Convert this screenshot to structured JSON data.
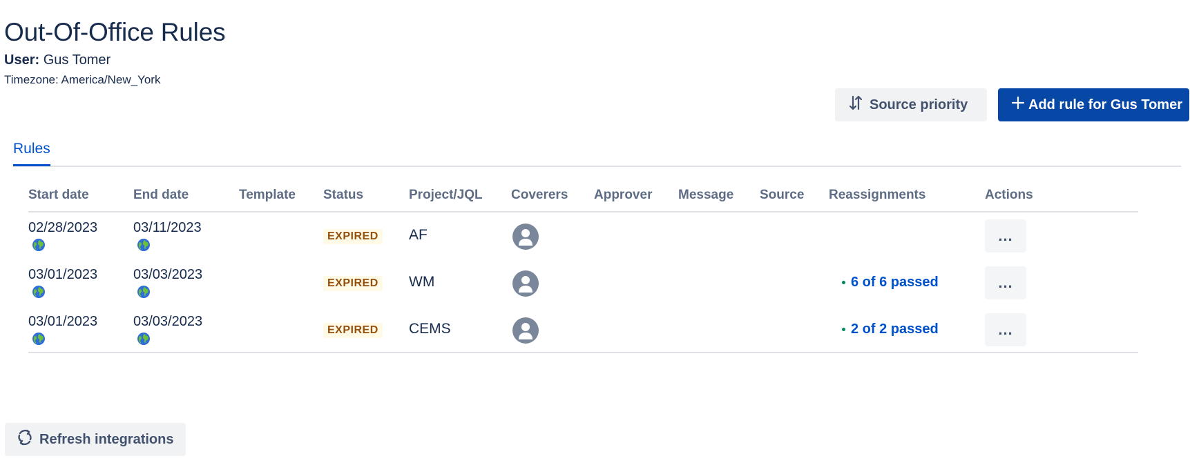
{
  "header": {
    "title": "Out-Of-Office Rules",
    "user_label": "User:",
    "user_name": "Gus Tomer",
    "timezone_text": "Timezone: America/New_York"
  },
  "toolbar": {
    "source_priority_label": "Source priority",
    "add_rule_label": "Add rule for Gus Tomer"
  },
  "tabs": [
    {
      "label": "Rules",
      "active": true
    }
  ],
  "table": {
    "columns": [
      "Start date",
      "End date",
      "Template",
      "Status",
      "Project/JQL",
      "Coverers",
      "Approver",
      "Message",
      "Source",
      "Reassignments",
      "Actions"
    ],
    "rows": [
      {
        "start_date": "02/28/2023",
        "end_date": "03/11/2023",
        "template": "",
        "status": "EXPIRED",
        "project": "AF",
        "coverer_icon": "user-avatar-icon",
        "approver": "",
        "message": "",
        "source": "",
        "reassignments": "",
        "actions": "..."
      },
      {
        "start_date": "03/01/2023",
        "end_date": "03/03/2023",
        "template": "",
        "status": "EXPIRED",
        "project": "WM",
        "coverer_icon": "user-avatar-icon",
        "approver": "",
        "message": "",
        "source": "",
        "reassignments": "6 of 6 passed",
        "actions": "..."
      },
      {
        "start_date": "03/01/2023",
        "end_date": "03/03/2023",
        "template": "",
        "status": "EXPIRED",
        "project": "CEMS",
        "coverer_icon": "user-avatar-icon",
        "approver": "",
        "message": "",
        "source": "",
        "reassignments": "2 of 2 passed",
        "actions": "..."
      }
    ]
  },
  "footer": {
    "refresh_label": "Refresh integrations"
  },
  "colors": {
    "primary": "#0747a6",
    "link": "#0052cc",
    "status_expired_text": "#974f0c",
    "status_expired_bg": "#fffae6",
    "success_dot": "#00875a"
  }
}
